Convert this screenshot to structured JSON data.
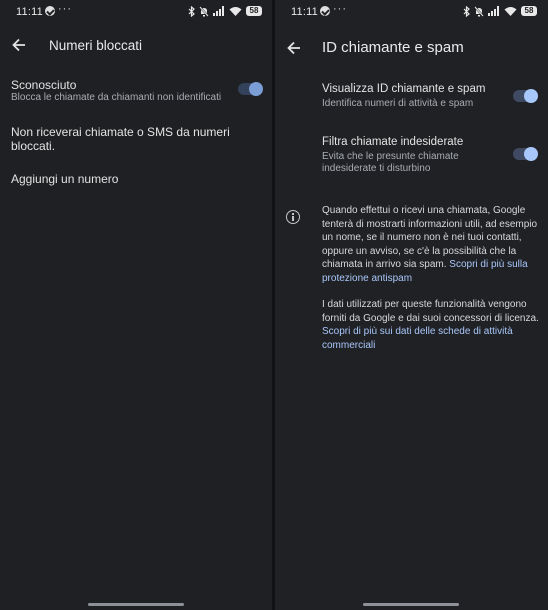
{
  "left": {
    "status": {
      "time": "11:11",
      "more": "···"
    },
    "header": {
      "title": "Numeri bloccati"
    },
    "unknown": {
      "title": "Sconosciuto",
      "subtitle": "Blocca le chiamate da chiamanti non identificati",
      "enabled": true
    },
    "notice": "Non riceverai chiamate o SMS da numeri bloccati.",
    "add_number": "Aggiungi un numero"
  },
  "right": {
    "status": {
      "time": "11:11",
      "more": "···"
    },
    "header": {
      "title": "ID chiamante e spam"
    },
    "caller_id": {
      "title": "Visualizza ID chiamante e spam",
      "subtitle": "Identifica numeri di attività e spam",
      "enabled": true
    },
    "filter": {
      "title": "Filtra chiamate indesiderate",
      "subtitle_1": "Evita che le presunte chiamate",
      "subtitle_2": "indesiderate ti disturbino",
      "enabled": true
    },
    "info": {
      "p1": [
        "Quando effettui o ricevi una chiamata, Google",
        "tenterà di mostrarti informazioni utili, ad esempio",
        "un nome, se il numero non è nei tuoi contatti,",
        "oppure un avviso, se c'è la possibilità che la"
      ],
      "p1_last_text": "chiamata in arrivo sia spam. ",
      "p1_link_1": "Scopri di più sulla",
      "p1_link_2": "protezione antispam",
      "p2": [
        "I dati utilizzati per queste funzionalità vengono",
        "forniti da Google e dai suoi concessori di licenza."
      ],
      "p2_link_1": "Scopri di più sui dati delle schede di attività",
      "p2_link_2": "commerciali"
    }
  },
  "icons": {
    "back": "arrow-left",
    "telegram": "telegram",
    "bluetooth": "bluetooth",
    "mute": "bell-off",
    "signal": "cell-signal",
    "wifi": "wifi",
    "battery": "battery",
    "battery_level": "58",
    "info": "info-circle"
  },
  "colors": {
    "accent": "#a8c7fa",
    "background": "#202124",
    "toggle_track": "#3f4a62"
  }
}
